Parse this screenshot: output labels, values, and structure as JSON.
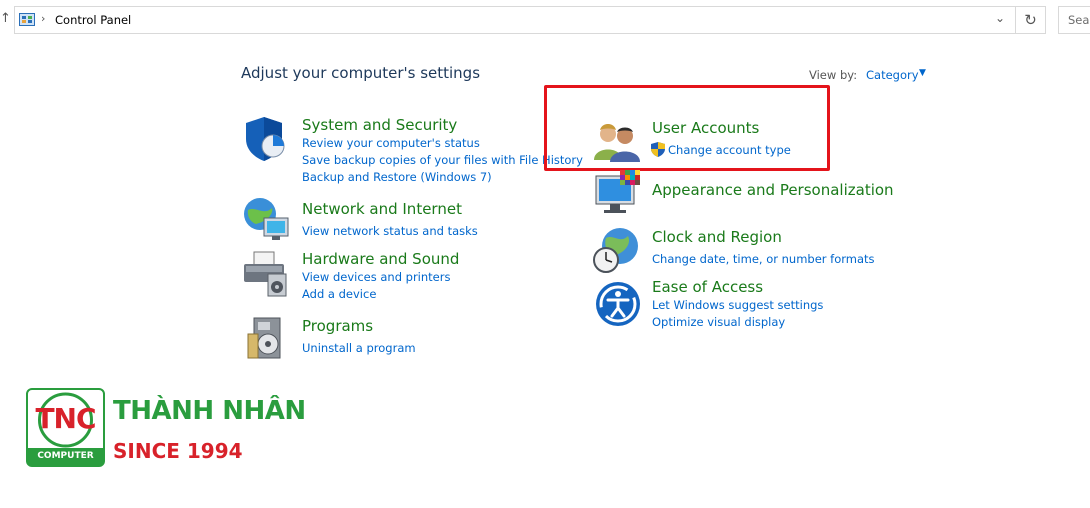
{
  "address": {
    "path": "Control Panel",
    "search_placeholder": "Sear"
  },
  "page_title": "Adjust your computer's settings",
  "view_by": {
    "label": "View by:",
    "value": "Category"
  },
  "categories": {
    "system": {
      "title": "System and Security",
      "links": [
        "Review your computer's status",
        "Save backup copies of your files with File History",
        "Backup and Restore (Windows 7)"
      ]
    },
    "network": {
      "title": "Network and Internet",
      "links": [
        "View network status and tasks"
      ]
    },
    "hardware": {
      "title": "Hardware and Sound",
      "links": [
        "View devices and printers",
        "Add a device"
      ]
    },
    "programs": {
      "title": "Programs",
      "links": [
        "Uninstall a program"
      ]
    },
    "user_accounts": {
      "title": "User Accounts",
      "links": [
        "Change account type"
      ]
    },
    "appearance": {
      "title": "Appearance and Personalization",
      "links": []
    },
    "clock": {
      "title": "Clock and Region",
      "links": [
        "Change date, time, or number formats"
      ]
    },
    "ease": {
      "title": "Ease of Access",
      "links": [
        "Let Windows suggest settings",
        "Optimize visual display"
      ]
    }
  },
  "watermark": {
    "logo_text": "TNC",
    "logo_sub": "COMPUTER",
    "brand": "THÀNH NHÂN",
    "since": "SINCE 1994"
  },
  "colors": {
    "category_green": "#1a7a1a",
    "link_blue": "#0066cc",
    "highlight_red": "#e4141b",
    "brand_green": "#2a9d3e",
    "brand_red": "#d8222a"
  }
}
